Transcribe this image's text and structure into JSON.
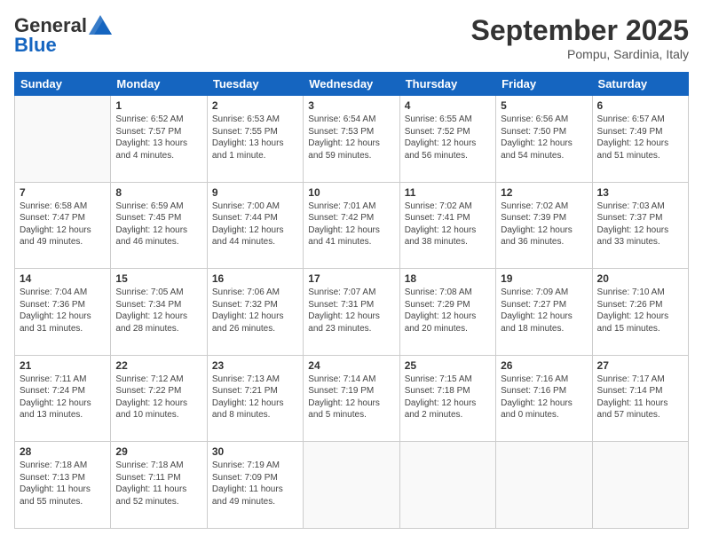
{
  "header": {
    "logo_line1": "General",
    "logo_line2": "Blue",
    "month": "September 2025",
    "location": "Pompu, Sardinia, Italy"
  },
  "weekdays": [
    "Sunday",
    "Monday",
    "Tuesday",
    "Wednesday",
    "Thursday",
    "Friday",
    "Saturday"
  ],
  "weeks": [
    [
      {
        "day": "",
        "info": ""
      },
      {
        "day": "1",
        "info": "Sunrise: 6:52 AM\nSunset: 7:57 PM\nDaylight: 13 hours\nand 4 minutes."
      },
      {
        "day": "2",
        "info": "Sunrise: 6:53 AM\nSunset: 7:55 PM\nDaylight: 13 hours\nand 1 minute."
      },
      {
        "day": "3",
        "info": "Sunrise: 6:54 AM\nSunset: 7:53 PM\nDaylight: 12 hours\nand 59 minutes."
      },
      {
        "day": "4",
        "info": "Sunrise: 6:55 AM\nSunset: 7:52 PM\nDaylight: 12 hours\nand 56 minutes."
      },
      {
        "day": "5",
        "info": "Sunrise: 6:56 AM\nSunset: 7:50 PM\nDaylight: 12 hours\nand 54 minutes."
      },
      {
        "day": "6",
        "info": "Sunrise: 6:57 AM\nSunset: 7:49 PM\nDaylight: 12 hours\nand 51 minutes."
      }
    ],
    [
      {
        "day": "7",
        "info": "Sunrise: 6:58 AM\nSunset: 7:47 PM\nDaylight: 12 hours\nand 49 minutes."
      },
      {
        "day": "8",
        "info": "Sunrise: 6:59 AM\nSunset: 7:45 PM\nDaylight: 12 hours\nand 46 minutes."
      },
      {
        "day": "9",
        "info": "Sunrise: 7:00 AM\nSunset: 7:44 PM\nDaylight: 12 hours\nand 44 minutes."
      },
      {
        "day": "10",
        "info": "Sunrise: 7:01 AM\nSunset: 7:42 PM\nDaylight: 12 hours\nand 41 minutes."
      },
      {
        "day": "11",
        "info": "Sunrise: 7:02 AM\nSunset: 7:41 PM\nDaylight: 12 hours\nand 38 minutes."
      },
      {
        "day": "12",
        "info": "Sunrise: 7:02 AM\nSunset: 7:39 PM\nDaylight: 12 hours\nand 36 minutes."
      },
      {
        "day": "13",
        "info": "Sunrise: 7:03 AM\nSunset: 7:37 PM\nDaylight: 12 hours\nand 33 minutes."
      }
    ],
    [
      {
        "day": "14",
        "info": "Sunrise: 7:04 AM\nSunset: 7:36 PM\nDaylight: 12 hours\nand 31 minutes."
      },
      {
        "day": "15",
        "info": "Sunrise: 7:05 AM\nSunset: 7:34 PM\nDaylight: 12 hours\nand 28 minutes."
      },
      {
        "day": "16",
        "info": "Sunrise: 7:06 AM\nSunset: 7:32 PM\nDaylight: 12 hours\nand 26 minutes."
      },
      {
        "day": "17",
        "info": "Sunrise: 7:07 AM\nSunset: 7:31 PM\nDaylight: 12 hours\nand 23 minutes."
      },
      {
        "day": "18",
        "info": "Sunrise: 7:08 AM\nSunset: 7:29 PM\nDaylight: 12 hours\nand 20 minutes."
      },
      {
        "day": "19",
        "info": "Sunrise: 7:09 AM\nSunset: 7:27 PM\nDaylight: 12 hours\nand 18 minutes."
      },
      {
        "day": "20",
        "info": "Sunrise: 7:10 AM\nSunset: 7:26 PM\nDaylight: 12 hours\nand 15 minutes."
      }
    ],
    [
      {
        "day": "21",
        "info": "Sunrise: 7:11 AM\nSunset: 7:24 PM\nDaylight: 12 hours\nand 13 minutes."
      },
      {
        "day": "22",
        "info": "Sunrise: 7:12 AM\nSunset: 7:22 PM\nDaylight: 12 hours\nand 10 minutes."
      },
      {
        "day": "23",
        "info": "Sunrise: 7:13 AM\nSunset: 7:21 PM\nDaylight: 12 hours\nand 8 minutes."
      },
      {
        "day": "24",
        "info": "Sunrise: 7:14 AM\nSunset: 7:19 PM\nDaylight: 12 hours\nand 5 minutes."
      },
      {
        "day": "25",
        "info": "Sunrise: 7:15 AM\nSunset: 7:18 PM\nDaylight: 12 hours\nand 2 minutes."
      },
      {
        "day": "26",
        "info": "Sunrise: 7:16 AM\nSunset: 7:16 PM\nDaylight: 12 hours\nand 0 minutes."
      },
      {
        "day": "27",
        "info": "Sunrise: 7:17 AM\nSunset: 7:14 PM\nDaylight: 11 hours\nand 57 minutes."
      }
    ],
    [
      {
        "day": "28",
        "info": "Sunrise: 7:18 AM\nSunset: 7:13 PM\nDaylight: 11 hours\nand 55 minutes."
      },
      {
        "day": "29",
        "info": "Sunrise: 7:18 AM\nSunset: 7:11 PM\nDaylight: 11 hours\nand 52 minutes."
      },
      {
        "day": "30",
        "info": "Sunrise: 7:19 AM\nSunset: 7:09 PM\nDaylight: 11 hours\nand 49 minutes."
      },
      {
        "day": "",
        "info": ""
      },
      {
        "day": "",
        "info": ""
      },
      {
        "day": "",
        "info": ""
      },
      {
        "day": "",
        "info": ""
      }
    ]
  ]
}
